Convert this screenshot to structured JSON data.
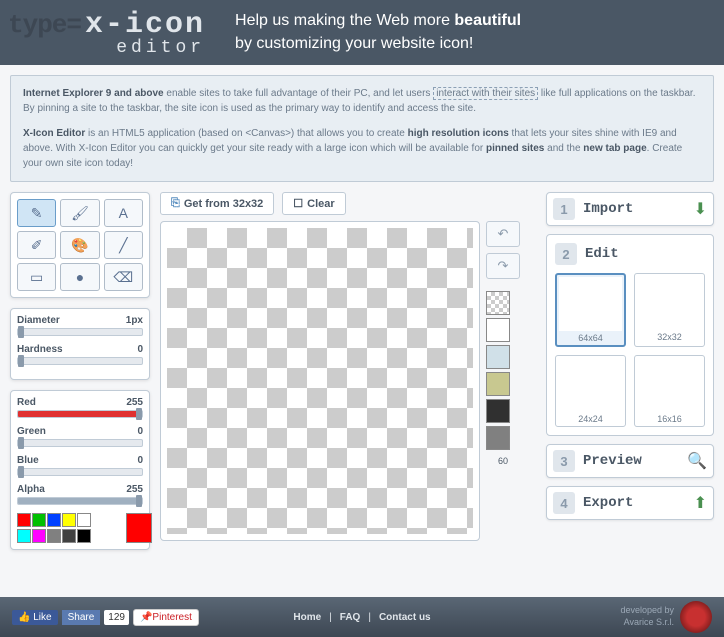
{
  "header": {
    "logo_prefix": "type=",
    "logo_main": "x-icon",
    "logo_sub": "editor",
    "slogan_1": "Help us making the Web more ",
    "slogan_bold": "beautiful",
    "slogan_2": "by customizing your website icon!"
  },
  "desc": {
    "p1_b1": "Internet Explorer 9 and above",
    "p1_t1": " enable sites to take full advantage of their PC, and let users ",
    "p1_hl": "interact with their sites",
    "p1_t2": " like full applications on the taskbar. By pinning a site to the taskbar, the site icon is used as the primary way to identify and access the site.",
    "p2_b1": "X-Icon Editor",
    "p2_t1": " is an HTML5 application (based on <Canvas>) that allows you to create ",
    "p2_b2": "high resolution icons",
    "p2_t2": " that lets your sites shine with IE9 and above. With X-Icon Editor you can quickly get your site ready with a large icon which will be available for ",
    "p2_b3": "pinned sites",
    "p2_t3": " and the ",
    "p2_b4": "new tab page",
    "p2_t4": ". Create your own site icon today!"
  },
  "sliders": {
    "diameter": {
      "label": "Diameter",
      "value": "1px",
      "pct": 0
    },
    "hardness": {
      "label": "Hardness",
      "value": "0",
      "pct": 0
    },
    "red": {
      "label": "Red",
      "value": "255",
      "pct": 100
    },
    "green": {
      "label": "Green",
      "value": "0",
      "pct": 0
    },
    "blue": {
      "label": "Blue",
      "value": "0",
      "pct": 0
    },
    "alpha": {
      "label": "Alpha",
      "value": "255",
      "pct": 100
    }
  },
  "swatches": {
    "row1": [
      "#ff0000",
      "#00c000",
      "#0040ff",
      "#ffff00",
      "#ffffff"
    ],
    "row2": [
      "#00ffff",
      "#ff00ff",
      "#808080",
      "#404040",
      "#000000"
    ],
    "current": "#ff0000"
  },
  "canvas_bar": {
    "get_from": "Get from 32x32",
    "clear": "Clear"
  },
  "palette": [
    {
      "color": "checker"
    },
    {
      "color": "#ffffff"
    },
    {
      "color": "#d0e0e8"
    },
    {
      "color": "#c8c890"
    },
    {
      "color": "#303030"
    },
    {
      "color": "#808080"
    }
  ],
  "palette_label": "60",
  "steps": {
    "s1": {
      "num": "1",
      "label": "Import"
    },
    "s2": {
      "num": "2",
      "label": "Edit"
    },
    "s3": {
      "num": "3",
      "label": "Preview"
    },
    "s4": {
      "num": "4",
      "label": "Export"
    }
  },
  "sizes": [
    {
      "label": "64x64",
      "active": true
    },
    {
      "label": "32x32",
      "active": false
    },
    {
      "label": "24x24",
      "active": false
    },
    {
      "label": "16x16",
      "active": false
    }
  ],
  "footer": {
    "like": "Like",
    "share": "Share",
    "count": "129",
    "pinterest": "Pinterest",
    "links": [
      "Home",
      "FAQ",
      "Contact us"
    ],
    "dev1": "developed by",
    "dev2": "Avarice S.r.l."
  }
}
